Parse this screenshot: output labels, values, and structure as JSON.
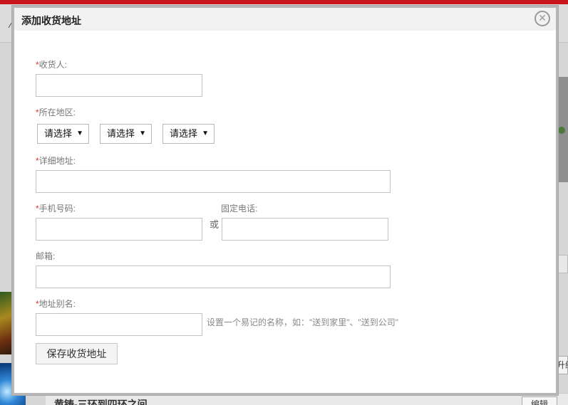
{
  "background": {
    "upgrade_text": "升级",
    "bottom_title": "黄铸-三环到四环之间",
    "edit_label": "编辑"
  },
  "dialog": {
    "title": "添加收货地址",
    "close_glyph": "✕"
  },
  "form": {
    "required_mark": "*",
    "receiver": {
      "label": "收货人:",
      "value": ""
    },
    "region": {
      "label": "所在地区:",
      "province": "请选择",
      "city": "请选择",
      "district": "请选择",
      "arrow": "▼"
    },
    "address": {
      "label": "详细地址:",
      "value": ""
    },
    "mobile": {
      "label": "手机号码:",
      "value": ""
    },
    "or_text": "或",
    "phone": {
      "label": "固定电话:",
      "value": ""
    },
    "email": {
      "label": "邮箱:",
      "value": ""
    },
    "alias": {
      "label": "地址别名:",
      "value": "",
      "hint": "设置一个易记的名称，如：\"送到家里\"、\"送到公司\""
    },
    "save_label": "保存收货地址"
  },
  "colors": {
    "required": "#d9362c",
    "label": "#777777",
    "input_border": "#c2c2c2",
    "top_bar": "#c8161d"
  }
}
